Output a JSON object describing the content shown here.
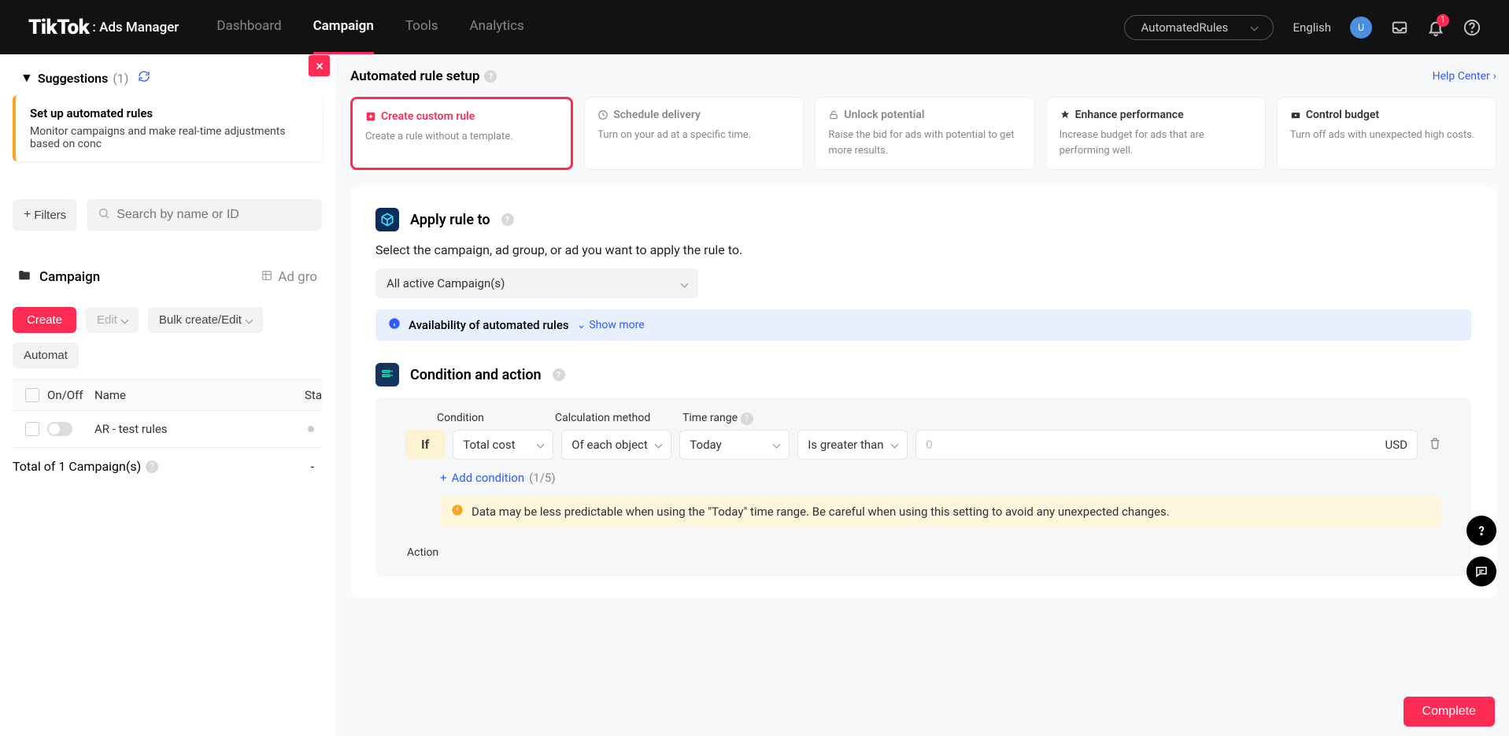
{
  "header": {
    "logo": "TikTok",
    "logo_suffix": ": Ads Manager",
    "nav": [
      "Dashboard",
      "Campaign",
      "Tools",
      "Analytics"
    ],
    "active_nav_index": 1,
    "account": "AutomatedRules",
    "language": "English",
    "avatar_letter": "U",
    "notif_count": "1"
  },
  "left": {
    "suggestions_label": "Suggestions",
    "suggestions_count": "(1)",
    "sug_card": {
      "title": "Set up automated rules",
      "desc": "Monitor campaigns and make real-time adjustments based on conc"
    },
    "filters_label": "Filters",
    "search_placeholder": "Search by name or ID",
    "campaign_tab": "Campaign",
    "adgroup_tab": "Ad gro",
    "buttons": {
      "create": "Create",
      "edit": "Edit",
      "bulk": "Bulk create/Edit",
      "auto": "Automat"
    },
    "columns": {
      "onoff": "On/Off",
      "name": "Name",
      "status": "Sta"
    },
    "rows": [
      {
        "name": "AR - test rules"
      }
    ],
    "footer": "Total of 1 Campaign(s)",
    "footer_dash": "-"
  },
  "right": {
    "title": "Automated rule setup",
    "help": "Help Center",
    "templates": [
      {
        "title": "Create custom rule",
        "desc": "Create a rule without a template.",
        "selected": true
      },
      {
        "title": "Schedule delivery",
        "desc": "Turn on your ad at a specific time."
      },
      {
        "title": "Unlock potential",
        "desc": "Raise the bid for ads with potential to get more results."
      },
      {
        "title": "Enhance performance",
        "desc": "Increase budget for ads that are performing well."
      },
      {
        "title": "Control budget",
        "desc": "Turn off ads with unexpected high costs."
      }
    ],
    "apply_section": {
      "title": "Apply rule to",
      "desc": "Select the campaign, ad group, or ad you want to apply the rule to.",
      "select_value": "All active Campaign(s)",
      "banner_title": "Availability of automated rules",
      "show_more": "Show more"
    },
    "cond_section": {
      "title": "Condition and action",
      "labels": {
        "cond": "Condition",
        "calc": "Calculation method",
        "time": "Time range"
      },
      "if": "If",
      "row": {
        "condition": "Total cost",
        "calc": "Of each object",
        "time": "Today",
        "op": "Is greater than",
        "value": "0",
        "currency": "USD"
      },
      "add_cond": "Add condition",
      "add_count": "(1/5)",
      "warn": "Data may be less predictable when using the \"Today\" time range. Be careful when using this setting to avoid any unexpected changes.",
      "action_label": "Action"
    },
    "complete": "Complete"
  }
}
